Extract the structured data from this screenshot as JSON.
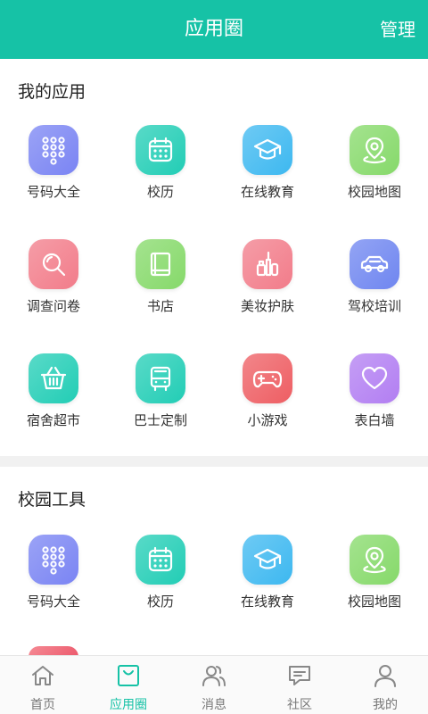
{
  "header": {
    "title": "应用圈",
    "manage_label": "管理"
  },
  "sections": [
    {
      "title": "我的应用",
      "apps": [
        {
          "label": "号码大全",
          "icon": "phone-keypad-icon",
          "color": "#7a84f3"
        },
        {
          "label": "校历",
          "icon": "calendar-icon",
          "color": "#22cdb5"
        },
        {
          "label": "在线教育",
          "icon": "graduation-cap-icon",
          "color": "#3db8f0"
        },
        {
          "label": "校园地图",
          "icon": "map-pin-icon",
          "color": "#86d96a"
        },
        {
          "label": "调查问卷",
          "icon": "magnifier-icon",
          "color": "#f27c8a"
        },
        {
          "label": "书店",
          "icon": "book-icon",
          "color": "#86d96a"
        },
        {
          "label": "美妆护肤",
          "icon": "cosmetics-icon",
          "color": "#f27c8a"
        },
        {
          "label": "驾校培训",
          "icon": "car-icon",
          "color": "#6f86f0"
        },
        {
          "label": "宿舍超市",
          "icon": "basket-icon",
          "color": "#22cdb5"
        },
        {
          "label": "巴士定制",
          "icon": "bus-icon",
          "color": "#22cdb5"
        },
        {
          "label": "小游戏",
          "icon": "gamepad-icon",
          "color": "#ee5e63"
        },
        {
          "label": "表白墙",
          "icon": "heart-icon",
          "color": "#b27ef2"
        }
      ]
    },
    {
      "title": "校园工具",
      "apps": [
        {
          "label": "号码大全",
          "icon": "phone-keypad-icon",
          "color": "#7a84f3"
        },
        {
          "label": "校历",
          "icon": "calendar-icon",
          "color": "#22cdb5"
        },
        {
          "label": "在线教育",
          "icon": "graduation-cap-icon",
          "color": "#3db8f0"
        },
        {
          "label": "校园地图",
          "icon": "map-pin-icon",
          "color": "#86d96a"
        }
      ]
    }
  ],
  "bottom_nav": [
    {
      "label": "首页",
      "icon": "home-icon",
      "active": false
    },
    {
      "label": "应用圈",
      "icon": "app-bag-icon",
      "active": true
    },
    {
      "label": "消息",
      "icon": "people-icon",
      "active": false
    },
    {
      "label": "社区",
      "icon": "chat-icon",
      "active": false
    },
    {
      "label": "我的",
      "icon": "person-icon",
      "active": false
    }
  ],
  "colors": {
    "accent": "#16c2a6"
  }
}
